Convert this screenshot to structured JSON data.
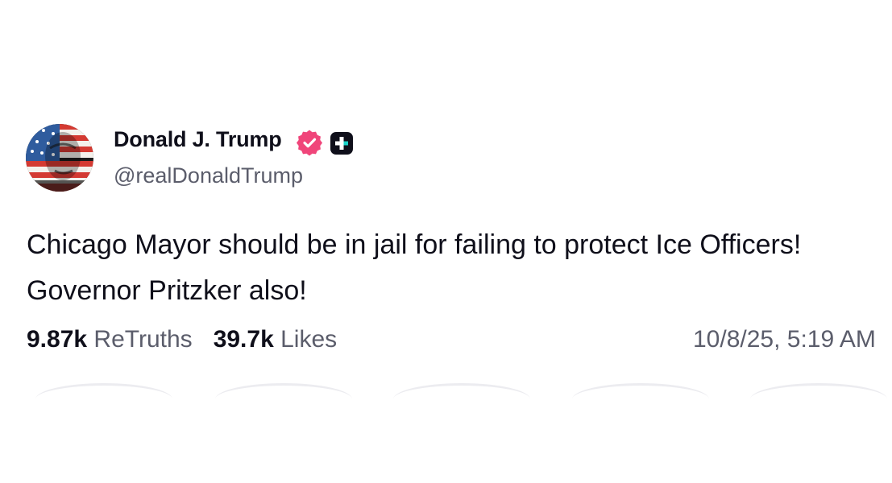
{
  "post": {
    "author_name": "Donald J. Trump",
    "handle": "@realDonaldTrump",
    "text": "Chicago Mayor should be in jail for failing to protect Ice Officers! Governor Pritzker also!",
    "retruths_count": "9.87k",
    "retruths_label": "ReTruths",
    "likes_count": "39.7k",
    "likes_label": "Likes",
    "timestamp": "10/8/25, 5:19 AM"
  },
  "icons": {
    "avatar": "avatar-flag-portrait",
    "verified": "verified-badge-icon",
    "plus": "plus-badge-icon"
  },
  "colors": {
    "text_primary": "#0f0f1a",
    "text_secondary": "#5b5d6b",
    "verified_badge": "#f0457a",
    "plus_badge": "#0f0f1a",
    "plus_accent": "#18d2c7"
  }
}
